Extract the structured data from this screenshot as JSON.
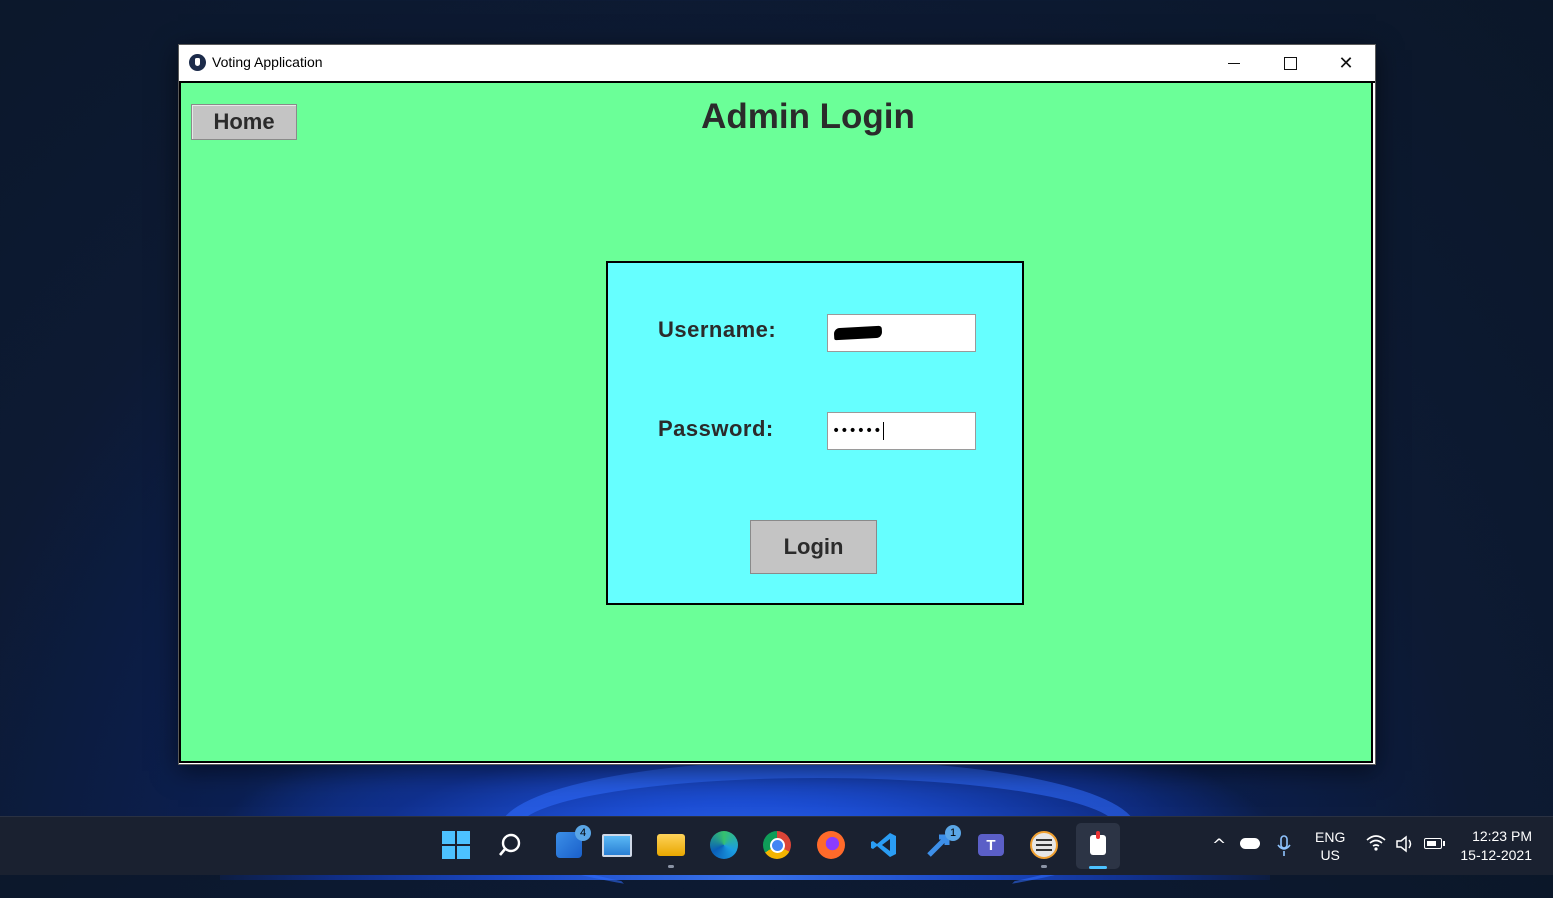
{
  "window": {
    "title": "Voting Application",
    "minimize": "—",
    "maximize": "☐",
    "close": "✕"
  },
  "app": {
    "home_label": "Home",
    "page_title": "Admin Login",
    "username_label": "Username:",
    "password_label": "Password:",
    "password_value": "••••••",
    "login_label": "Login",
    "colors": {
      "background": "#6bff98",
      "panel": "#66ffff",
      "button": "#c4c4c4"
    }
  },
  "taskbar": {
    "icons": [
      "start-icon",
      "search-icon",
      "widgets-icon",
      "desktop-icon",
      "file-explorer-icon",
      "edge-icon",
      "chrome-icon",
      "firefox-icon",
      "vscode-icon",
      "deploy-app-icon",
      "teams-icon",
      "terminal-icon",
      "voting-app-icon"
    ],
    "widgets_badge": "4",
    "deploy_badge": "1",
    "lang_top": "ENG",
    "lang_bottom": "US",
    "time": "12:23 PM",
    "date": "15-12-2021"
  }
}
